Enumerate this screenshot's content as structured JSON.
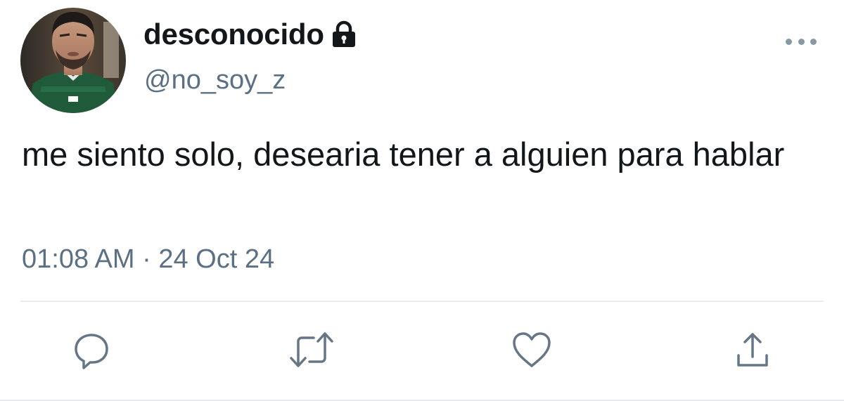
{
  "user": {
    "display_name": "desconocido",
    "handle": "@no_soy_z",
    "avatar_icon": "profile-photo",
    "protected_icon": "lock-icon"
  },
  "tweet": {
    "text": "me siento solo, desearia tener a alguien para hablar",
    "timestamp": "01:08 AM · 24 Oct 24"
  },
  "actions": [
    {
      "icon": "reply-icon"
    },
    {
      "icon": "retweet-icon"
    },
    {
      "icon": "like-icon"
    },
    {
      "icon": "share-icon"
    }
  ],
  "colors": {
    "text": "#14171a",
    "secondary": "#5b7083",
    "icon": "#657786",
    "divider": "#e6ecf0"
  }
}
